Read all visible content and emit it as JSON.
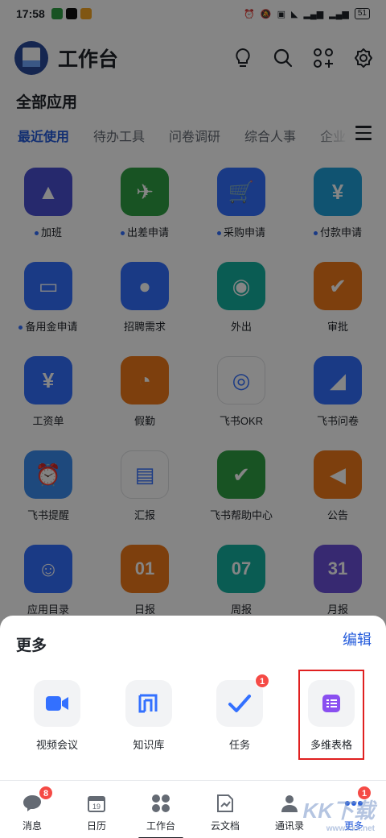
{
  "status_bar": {
    "time": "17:58",
    "battery": "51"
  },
  "header": {
    "title": "工作台"
  },
  "section_title": "全部应用",
  "tabs": [
    {
      "label": "最近使用",
      "active": true
    },
    {
      "label": "待办工具"
    },
    {
      "label": "问卷调研"
    },
    {
      "label": "综合人事"
    },
    {
      "label": "企业"
    }
  ],
  "apps": [
    {
      "label": "加班",
      "dot": true,
      "color": "#4a4fd1",
      "icon": "lamp-icon"
    },
    {
      "label": "出差申请",
      "dot": true,
      "color": "#2ea043",
      "icon": "airplane-icon"
    },
    {
      "label": "采购申请",
      "dot": true,
      "color": "#3370ff",
      "icon": "cart-icon"
    },
    {
      "label": "付款申请",
      "dot": true,
      "color": "#20a0d8",
      "icon": "yen-icon"
    },
    {
      "label": "备用金申请",
      "dot": true,
      "color": "#3370ff",
      "icon": "wallet-icon"
    },
    {
      "label": "招聘需求",
      "color": "#3370ff",
      "icon": "person-icon"
    },
    {
      "label": "外出",
      "color": "#15b1a0",
      "icon": "location-icon"
    },
    {
      "label": "审批",
      "color": "#f07a1a",
      "icon": "approval-icon"
    },
    {
      "label": "工资单",
      "color": "#3370ff",
      "icon": "payslip-icon"
    },
    {
      "label": "假勤",
      "color": "#f07a1a",
      "icon": "leave-icon"
    },
    {
      "label": "飞书OKR",
      "color": "#ffffff",
      "icon": "okr-icon"
    },
    {
      "label": "飞书问卷",
      "color": "#3370ff",
      "icon": "survey-icon"
    },
    {
      "label": "飞书提醒",
      "color": "#3a8df0",
      "icon": "alarm-icon"
    },
    {
      "label": "汇报",
      "color": "#ffffff",
      "icon": "report-icon"
    },
    {
      "label": "飞书帮助中心",
      "color": "#2ea043",
      "icon": "help-center-icon"
    },
    {
      "label": "公告",
      "color": "#f07a1a",
      "icon": "announcement-icon"
    },
    {
      "label": "应用目录",
      "color": "#3370ff",
      "icon": "app-directory-icon"
    },
    {
      "label": "日报",
      "color": "#f07a1a",
      "icon": "daily-report-icon",
      "text": "01"
    },
    {
      "label": "周报",
      "color": "#15b1a0",
      "icon": "weekly-report-icon",
      "text": "07"
    },
    {
      "label": "月报",
      "color": "#6a4fd8",
      "icon": "monthly-report-icon",
      "text": "31"
    }
  ],
  "sheet": {
    "title": "更多",
    "edit_label": "编辑",
    "items": [
      {
        "label": "视频会议",
        "icon": "video-meeting-icon"
      },
      {
        "label": "知识库",
        "icon": "wiki-icon"
      },
      {
        "label": "任务",
        "icon": "task-icon",
        "badge": "1"
      },
      {
        "label": "多维表格",
        "icon": "bitable-icon"
      }
    ]
  },
  "bottom_nav": [
    {
      "label": "消息",
      "badge": "8",
      "icon": "message-icon"
    },
    {
      "label": "日历",
      "icon": "calendar-icon",
      "calendar_day": "19"
    },
    {
      "label": "工作台",
      "icon": "workplace-icon"
    },
    {
      "label": "云文档",
      "icon": "docs-icon"
    },
    {
      "label": "通讯录",
      "icon": "contacts-icon"
    },
    {
      "label": "更多",
      "badge": "1",
      "icon": "more-icon",
      "active": true
    }
  ],
  "watermark": {
    "main": "KK下载",
    "sub": "www.kkx.net"
  }
}
